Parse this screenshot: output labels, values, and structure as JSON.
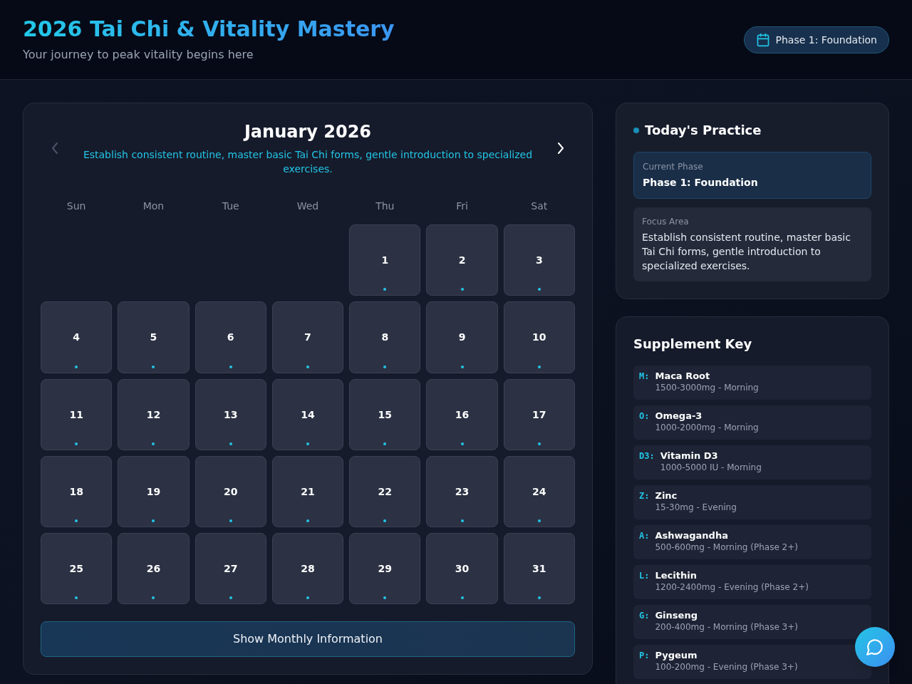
{
  "header": {
    "title": "2026 Tai Chi & Vitality Mastery",
    "subtitle": "Your journey to peak vitality begins here",
    "phase_badge": "Phase 1: Foundation"
  },
  "calendar": {
    "month": "January 2026",
    "description": "Establish consistent routine, master basic Tai Chi forms, gentle introduction to specialized exercises.",
    "prev": {
      "disabled": true
    },
    "next": {
      "disabled": false
    },
    "weekdays": [
      "Sun",
      "Mon",
      "Tue",
      "Wed",
      "Thu",
      "Fri",
      "Sat"
    ],
    "weeks": [
      {
        "days": [
          {
            "day": "1",
            "has_activity": true
          },
          {
            "day": "2",
            "has_activity": true
          },
          {
            "day": "3",
            "has_activity": true
          }
        ]
      },
      {
        "days": [
          {
            "day": "4",
            "has_activity": true
          },
          {
            "day": "5",
            "has_activity": true
          },
          {
            "day": "6",
            "has_activity": true
          },
          {
            "day": "7",
            "has_activity": true
          },
          {
            "day": "8",
            "has_activity": true
          },
          {
            "day": "9",
            "has_activity": true
          },
          {
            "day": "10",
            "has_activity": true
          }
        ]
      },
      {
        "days": [
          {
            "day": "11",
            "has_activity": true
          },
          {
            "day": "12",
            "has_activity": true
          },
          {
            "day": "13",
            "has_activity": true
          },
          {
            "day": "14",
            "has_activity": true
          },
          {
            "day": "15",
            "has_activity": true
          },
          {
            "day": "16",
            "has_activity": true
          },
          {
            "day": "17",
            "has_activity": true
          }
        ]
      },
      {
        "days": [
          {
            "day": "18",
            "has_activity": true
          },
          {
            "day": "19",
            "has_activity": true
          },
          {
            "day": "20",
            "has_activity": true
          },
          {
            "day": "21",
            "has_activity": true
          },
          {
            "day": "22",
            "has_activity": true
          },
          {
            "day": "23",
            "has_activity": true
          },
          {
            "day": "24",
            "has_activity": true
          }
        ]
      },
      {
        "days": [
          {
            "day": "25",
            "has_activity": true
          },
          {
            "day": "26",
            "has_activity": true
          },
          {
            "day": "27",
            "has_activity": true
          },
          {
            "day": "28",
            "has_activity": true
          },
          {
            "day": "29",
            "has_activity": true
          },
          {
            "day": "30",
            "has_activity": true
          },
          {
            "day": "31",
            "has_activity": true
          }
        ]
      }
    ],
    "button": "Show Monthly Information"
  },
  "today": {
    "title": "Today's Practice",
    "current_phase": {
      "label": "Current Phase",
      "value": "Phase 1: Foundation"
    },
    "focus_area": {
      "label": "Focus Area",
      "text": "Establish consistent routine, master basic Tai Chi forms, gentle introduction to specialized exercises."
    }
  },
  "supplements": {
    "title": "Supplement Key",
    "items": [
      {
        "code": "M:",
        "name": "Maca Root",
        "detail": "1500-3000mg - Morning"
      },
      {
        "code": "O:",
        "name": "Omega-3",
        "detail": "1000-2000mg - Morning"
      },
      {
        "code": "D3:",
        "name": "Vitamin D3",
        "detail": "1000-5000 IU - Morning"
      },
      {
        "code": "Z:",
        "name": "Zinc",
        "detail": "15-30mg - Evening"
      },
      {
        "code": "A:",
        "name": "Ashwagandha",
        "detail": "500-600mg - Morning (Phase 2+)"
      },
      {
        "code": "L:",
        "name": "Lecithin",
        "detail": "1200-2400mg - Evening (Phase 2+)"
      },
      {
        "code": "G:",
        "name": "Ginseng",
        "detail": "200-400mg - Morning (Phase 3+)"
      },
      {
        "code": "P:",
        "name": "Pygeum",
        "detail": "100-200mg - Evening (Phase 3+)"
      }
    ]
  }
}
